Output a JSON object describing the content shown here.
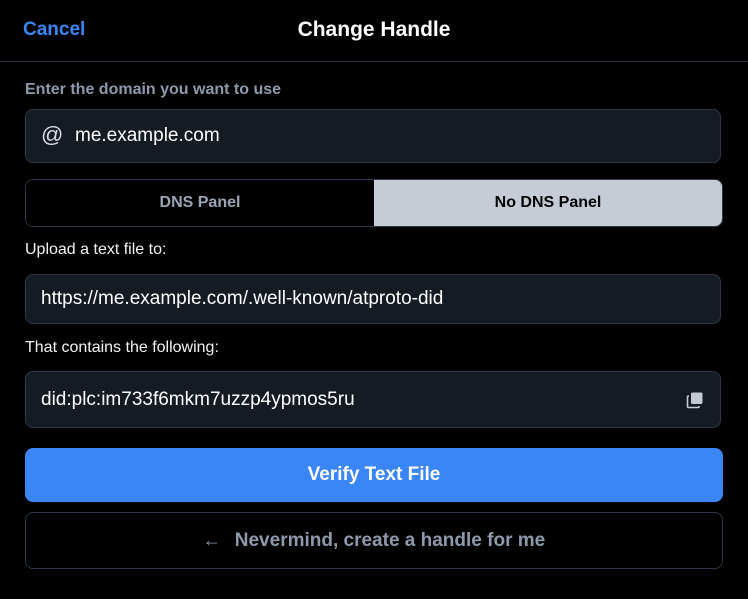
{
  "header": {
    "cancel_label": "Cancel",
    "title": "Change Handle"
  },
  "domain": {
    "label": "Enter the domain you want to use",
    "at_symbol": "@",
    "value": "me.example.com"
  },
  "tabs": [
    {
      "label": "DNS Panel",
      "selected": false
    },
    {
      "label": "No DNS Panel",
      "selected": true
    }
  ],
  "upload": {
    "label": "Upload a text file to:",
    "url": "https://me.example.com/.well-known/atproto-did"
  },
  "contents": {
    "label": "That contains the following:",
    "did": "did:plc:im733f6mkm7uzzp4ypmos5ru",
    "copy_icon": "copy-icon"
  },
  "verify_button_label": "Verify Text File",
  "nevermind": {
    "arrow": "←",
    "label": "Nevermind, create a handle for me"
  },
  "colors": {
    "background": "#000000",
    "accent": "#3a86f6",
    "field_bg": "#141b23",
    "border": "#2d3744",
    "active_tab": "#c5ccd6"
  }
}
